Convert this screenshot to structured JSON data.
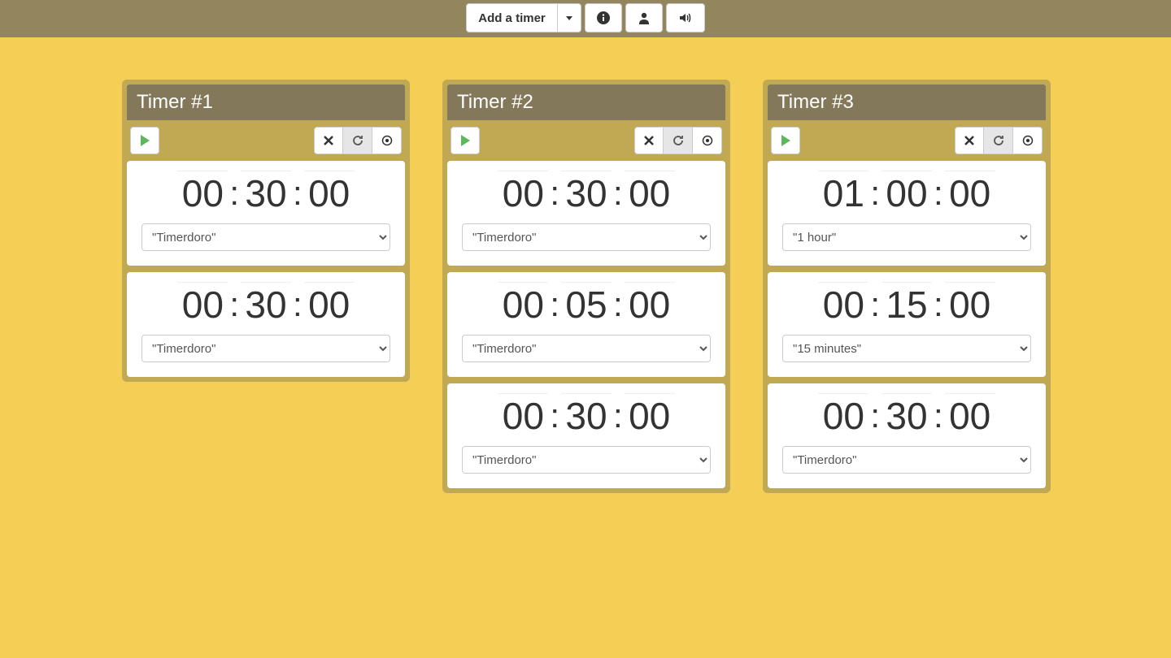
{
  "toolbar": {
    "add_label": "Add a timer"
  },
  "timers": [
    {
      "title": "Timer #1",
      "segments": [
        {
          "h": "00",
          "m": "30",
          "s": "00",
          "preset": "\"Timerdoro\""
        },
        {
          "h": "00",
          "m": "30",
          "s": "00",
          "preset": "\"Timerdoro\""
        }
      ]
    },
    {
      "title": "Timer #2",
      "segments": [
        {
          "h": "00",
          "m": "30",
          "s": "00",
          "preset": "\"Timerdoro\""
        },
        {
          "h": "00",
          "m": "05",
          "s": "00",
          "preset": "\"Timerdoro\""
        },
        {
          "h": "00",
          "m": "30",
          "s": "00",
          "preset": "\"Timerdoro\""
        }
      ]
    },
    {
      "title": "Timer #3",
      "segments": [
        {
          "h": "01",
          "m": "00",
          "s": "00",
          "preset": "\"1 hour\""
        },
        {
          "h": "00",
          "m": "15",
          "s": "00",
          "preset": "\"15 minutes\""
        },
        {
          "h": "00",
          "m": "30",
          "s": "00",
          "preset": "\"Timerdoro\""
        }
      ]
    }
  ]
}
